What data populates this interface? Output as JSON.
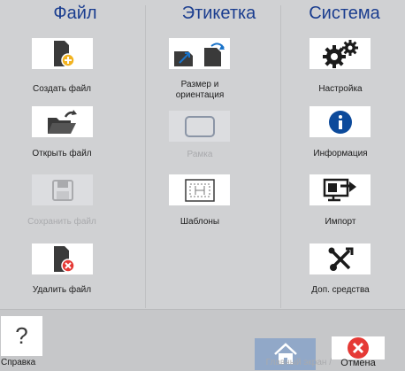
{
  "columns": {
    "file": {
      "title": "Файл"
    },
    "label": {
      "title": "Этикетка"
    },
    "system": {
      "title": "Система"
    }
  },
  "file_items": {
    "create": "Создать файл",
    "open": "Открыть файл",
    "save": "Сохранить файл",
    "delete": "Удалить файл"
  },
  "label_items": {
    "size": "Размер и ориентация",
    "frame": "Рамка",
    "templates": "Шаблоны"
  },
  "system_items": {
    "settings": "Настройка",
    "info": "Информация",
    "import": "Импорт",
    "tools": "Доп. средства"
  },
  "bottom": {
    "help_glyph": "?",
    "help": "Справка",
    "home": "Главный экран /",
    "cancel": "Отмена"
  },
  "colors": {
    "heading": "#1a3d8f",
    "icon": "#3a3a3a",
    "accent_orange": "#f2b320",
    "danger_red": "#e53935",
    "info_blue": "#0c4a9b"
  }
}
